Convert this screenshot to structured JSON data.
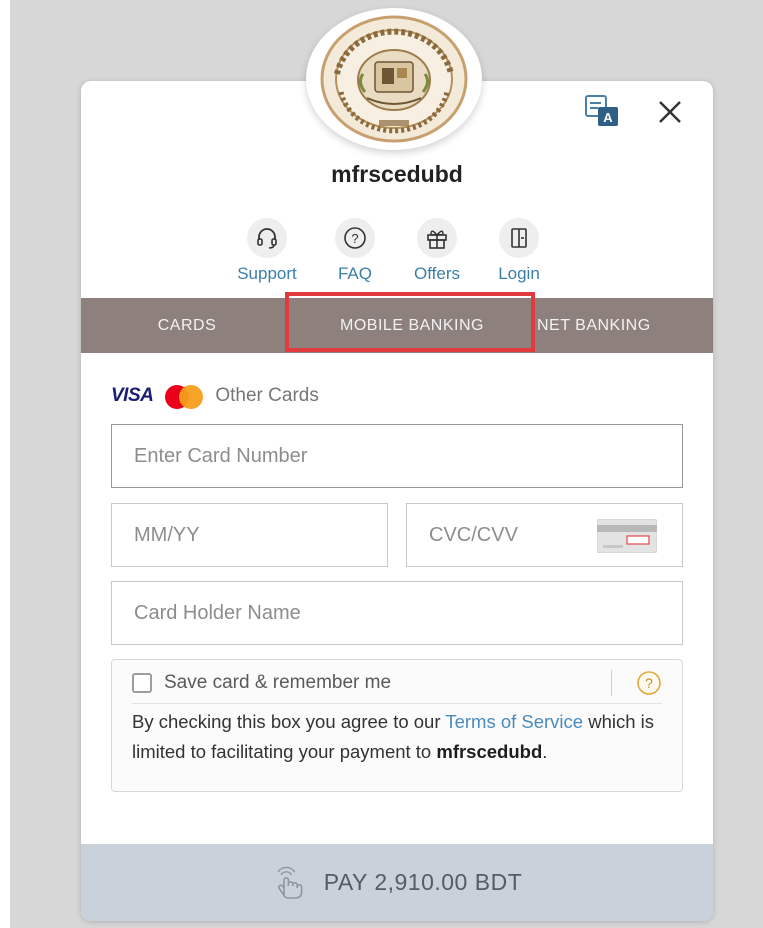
{
  "merchant": {
    "name": "mfrscedubd"
  },
  "logo": {
    "icon": "institution-seal-logo",
    "border_color": "#c8a070"
  },
  "header": {
    "translate_icon": "translate-icon",
    "close_icon": "close-icon"
  },
  "quick_links": [
    {
      "label": "Support",
      "icon": "headset-icon"
    },
    {
      "label": "FAQ",
      "icon": "question-icon"
    },
    {
      "label": "Offers",
      "icon": "gift-icon"
    },
    {
      "label": "Login",
      "icon": "login-door-icon"
    }
  ],
  "tabs": [
    {
      "label": "CARDS",
      "selected": false
    },
    {
      "label": "MOBILE BANKING",
      "selected": false,
      "highlighted": true
    },
    {
      "label": "NET BANKING",
      "selected": false
    }
  ],
  "card_brands": {
    "visa": "VISA",
    "mastercard": "mastercard-logo",
    "other_label": "Other Cards"
  },
  "form": {
    "card_number_placeholder": "Enter Card Number",
    "expiry_placeholder": "MM/YY",
    "cvc_placeholder": "CVC/CVV",
    "cvc_icon": "card-back-icon",
    "holder_name_placeholder": "Card Holder Name"
  },
  "save_card": {
    "label": "Save card & remember me",
    "checked": false,
    "help_icon": "help-circle-icon",
    "terms_prefix": "By checking this box you agree to our ",
    "terms_link": "Terms of Service",
    "terms_middle": " which is limited to facilitating your payment to ",
    "terms_merchant": "mfrscedubd",
    "terms_suffix": "."
  },
  "pay_button": {
    "label": "PAY 2,910.00 BDT",
    "icon": "tap-hand-icon"
  },
  "colors": {
    "tab_bar": "#8e817d",
    "link": "#3a7fa8",
    "highlight": "#e0393e",
    "pay_bar": "#c9d1da"
  }
}
